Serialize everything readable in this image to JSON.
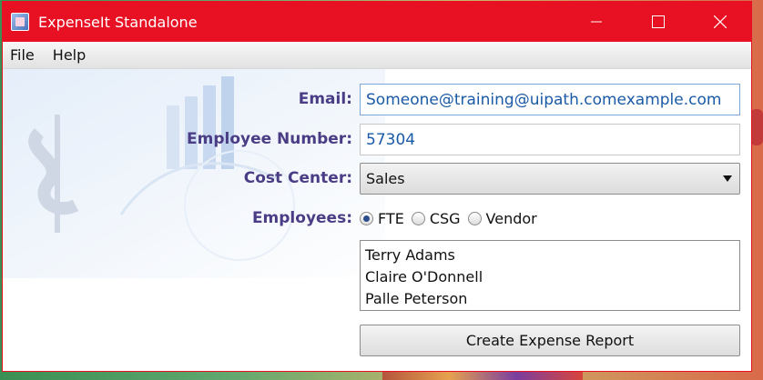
{
  "window": {
    "title": "ExpenseIt Standalone",
    "accent": "#e81123",
    "icon": "expenseit-app-icon"
  },
  "titlebar_controls": [
    "minimize-icon",
    "maximize-icon",
    "close-icon"
  ],
  "menu": {
    "items": [
      {
        "label": "File"
      },
      {
        "label": "Help"
      }
    ]
  },
  "form": {
    "email_label": "Email:",
    "email_value": "Someone@training@uipath.comexample.com",
    "employee_number_label": "Employee Number:",
    "employee_number_value": "57304",
    "cost_center_label": "Cost Center:",
    "cost_center_value": "Sales",
    "employees_label": "Employees:",
    "employee_types": [
      {
        "label": "FTE",
        "selected": true
      },
      {
        "label": "CSG",
        "selected": false
      },
      {
        "label": "Vendor",
        "selected": false
      }
    ],
    "employees": [
      "Terry Adams",
      "Claire O'Donnell",
      "Palle Peterson"
    ],
    "create_button_label": "Create Expense Report"
  },
  "colors": {
    "label_color": "#4a3d86",
    "input_text_color": "#1a5aa6"
  }
}
